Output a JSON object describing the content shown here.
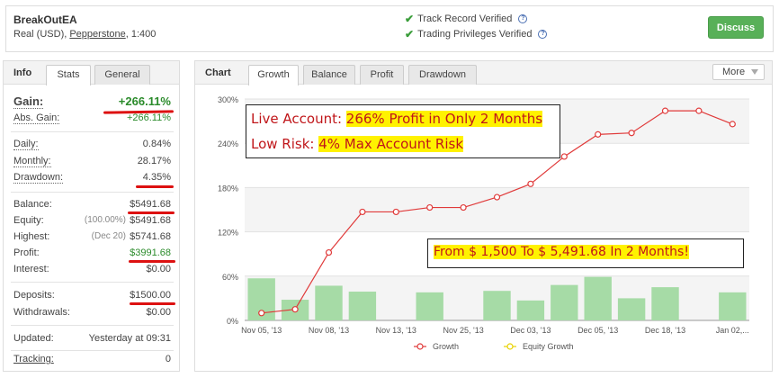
{
  "header": {
    "account_name": "BreakOutEA",
    "account_prefix": "Real (USD), ",
    "broker": "Pepperstone",
    "leverage": ", 1:400",
    "verify1": "Track Record Verified",
    "verify2": "Trading Privileges Verified",
    "discuss": "Discuss"
  },
  "left_tabs": {
    "title": "Info",
    "stats": "Stats",
    "general": "General"
  },
  "stats": {
    "gain_label": "Gain:",
    "gain": "+266.11%",
    "abs_gain_label": "Abs. Gain:",
    "abs_gain": "+266.11%",
    "daily_label": "Daily:",
    "daily": "0.84%",
    "monthly_label": "Monthly:",
    "monthly": "28.17%",
    "drawdown_label": "Drawdown:",
    "drawdown": "4.35%",
    "balance_label": "Balance:",
    "balance": "$5491.68",
    "equity_label": "Equity:",
    "equity_pct": "(100.00%)",
    "equity": "$5491.68",
    "highest_label": "Highest:",
    "highest_date": "(Dec 20)",
    "highest": "$5741.68",
    "profit_label": "Profit:",
    "profit": "$3991.68",
    "interest_label": "Interest:",
    "interest": "$0.00",
    "deposits_label": "Deposits:",
    "deposits": "$1500.00",
    "withdrawals_label": "Withdrawals:",
    "withdrawals": "$0.00",
    "updated_label": "Updated:",
    "updated": "Yesterday at 09:31",
    "tracking_label": "Tracking:",
    "tracking": "0"
  },
  "right_tabs": {
    "title": "Chart",
    "growth": "Growth",
    "balance": "Balance",
    "profit": "Profit",
    "drawdown": "Drawdown",
    "more": "More"
  },
  "annotations": {
    "line1_pre": "Live Account: ",
    "line1_hl": "266% Profit in Only 2 Months",
    "line2_pre": "Low Risk: ",
    "line2_hl": "4% Max Account Risk",
    "line3": "From $ 1,500 To $ 5,491.68 In 2 Months!"
  },
  "chart_data": {
    "type": "line",
    "x_tick_labels": [
      "Nov 05, '13",
      "Nov 08, '13",
      "Nov 13, '13",
      "Nov 25, '13",
      "Dec 03, '13",
      "Dec 05, '13",
      "Dec 18, '13",
      "Jan 02,..."
    ],
    "y_tick_labels": [
      "0%",
      "60%",
      "120%",
      "180%",
      "240%",
      "300%"
    ],
    "ylim": [
      0,
      300
    ],
    "series": [
      {
        "name": "Growth",
        "color": "#e03a3a",
        "values": [
          10,
          15,
          92,
          147,
          147,
          153,
          153,
          167,
          185,
          222,
          252,
          254,
          284,
          284,
          266
        ]
      },
      {
        "name": "Equity Growth",
        "color": "#e8d200",
        "values": []
      }
    ],
    "bars": {
      "color": "#a6dba6",
      "values": [
        57,
        28,
        47,
        39,
        0,
        38,
        0,
        40,
        27,
        48,
        59,
        30,
        45,
        0,
        38
      ]
    },
    "grid": true,
    "legend_position": "bottom"
  },
  "colors": {
    "accent_green": "#58b058",
    "gain_green": "#2b8b2b",
    "line_red": "#e03a3a",
    "annotation_red": "#c0161a",
    "highlight": "#fff200"
  }
}
